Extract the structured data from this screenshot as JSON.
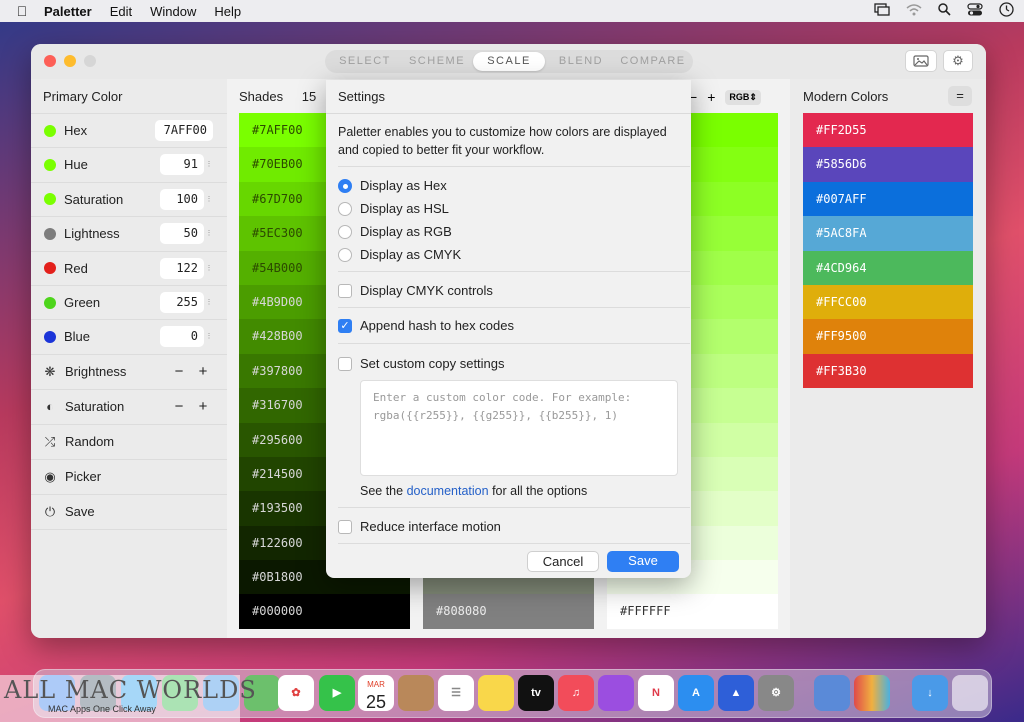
{
  "menubar": {
    "app": "Paletter",
    "items": [
      "Edit",
      "Window",
      "Help"
    ]
  },
  "toolbar": {
    "tabs": [
      "SELECT",
      "SCHEME",
      "SCALE",
      "BLEND",
      "COMPARE"
    ],
    "active_tab": "SCALE"
  },
  "primary": {
    "title": "Primary Color",
    "rows": [
      {
        "label": "Hex",
        "value": "7AFF00",
        "color": "#7aff00"
      },
      {
        "label": "Hue",
        "value": "91",
        "color": "#7aff00"
      },
      {
        "label": "Saturation",
        "value": "100",
        "color": "#7aff00"
      },
      {
        "label": "Lightness",
        "value": "50",
        "color": "#7d7d7d"
      },
      {
        "label": "Red",
        "value": "122",
        "color": "#e3201b"
      },
      {
        "label": "Green",
        "value": "255",
        "color": "#4ed51c"
      },
      {
        "label": "Blue",
        "value": "0",
        "color": "#1b34d8"
      }
    ],
    "adjust": [
      {
        "label": "Brightness",
        "icon": "sun-icon",
        "minus": "−",
        "plus": "+"
      },
      {
        "label": "Saturation",
        "icon": "contrast-icon",
        "minus": "−",
        "plus": "+"
      }
    ],
    "actions": [
      {
        "label": "Random",
        "icon": "shuffle-icon"
      },
      {
        "label": "Picker",
        "icon": "target-icon"
      },
      {
        "label": "Save",
        "icon": "power-icon"
      }
    ]
  },
  "shades": {
    "title": "Shades",
    "count": "15",
    "minus": "−",
    "plus": "+",
    "format": "RGB⇕",
    "col1": [
      "#7AFF00",
      "#70EB00",
      "#67D700",
      "#5EC300",
      "#54B000",
      "#4B9D00",
      "#428B00",
      "#397800",
      "#316700",
      "#295600",
      "#214500",
      "#193500",
      "#122600",
      "#0B1800",
      "#000000"
    ],
    "col2_last": "#808080",
    "col3_last": "#FFFFFF"
  },
  "modern": {
    "title": "Modern Colors",
    "menu": "=",
    "colors": [
      {
        "hex": "#FF2D55",
        "color": "#e3284f"
      },
      {
        "hex": "#5856D6",
        "color": "#5a46bb"
      },
      {
        "hex": "#007AFF",
        "color": "#0b6fdc"
      },
      {
        "hex": "#5AC8FA",
        "color": "#56a8d6"
      },
      {
        "hex": "#4CD964",
        "color": "#4cb95c"
      },
      {
        "hex": "#FFCC00",
        "color": "#dfae0b"
      },
      {
        "hex": "#FF9500",
        "color": "#df820b"
      },
      {
        "hex": "#FF3B30",
        "color": "#de3132"
      }
    ]
  },
  "settings": {
    "title": "Settings",
    "description": "Paletter enables you to customize how colors are displayed and copied to better fit your workflow.",
    "display_options": [
      "Display as Hex",
      "Display as HSL",
      "Display as RGB",
      "Display as CMYK"
    ],
    "selected_display": "Display as Hex",
    "cmyk_controls": "Display CMYK controls",
    "append_hash": "Append hash to hex codes",
    "custom_copy": "Set custom copy settings",
    "custom_placeholder": "Enter a custom color code. For example:\nrgba({{r255}}, {{g255}}, {{b255}}, 1)",
    "doc_prefix": "See the ",
    "doc_link": "documentation",
    "doc_suffix": " for all the options",
    "reduce_motion": "Reduce interface motion",
    "cancel": "Cancel",
    "save": "Save"
  },
  "dock": {
    "calendar_month": "MAR",
    "calendar_day": "25",
    "tv_label": "tv"
  },
  "watermark": {
    "title": "ALL MAC WORLDS",
    "subtitle": "MAC Apps One Click Away"
  }
}
